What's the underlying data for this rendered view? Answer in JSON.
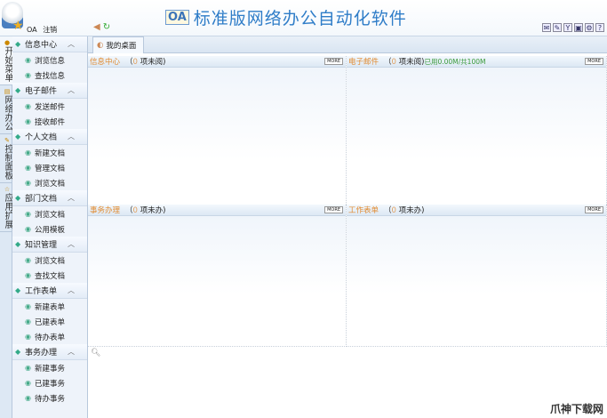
{
  "header": {
    "title": "标准版网络办公自动化软件",
    "logo": "OA",
    "user": "OA",
    "logout": "注销",
    "nav_icons": [
      "back-icon",
      "refresh-icon"
    ],
    "tool_icons": [
      "chat-icon",
      "edit-icon",
      "mail-icon",
      "image-icon",
      "settings-icon",
      "help-icon"
    ]
  },
  "vtabs": [
    {
      "label": "开始菜单",
      "icon": "bulb-icon"
    },
    {
      "label": "网络办公",
      "icon": "oa-icon"
    },
    {
      "label": "控制面板",
      "icon": "tools-icon"
    },
    {
      "label": "应用扩展",
      "icon": "star-icon"
    }
  ],
  "sidebar": {
    "groups": [
      {
        "label": "信息中心",
        "items": [
          "浏览信息",
          "查找信息"
        ]
      },
      {
        "label": "电子邮件",
        "items": [
          "发送邮件",
          "接收邮件"
        ]
      },
      {
        "label": "个人文档",
        "items": [
          "新建文档",
          "管理文档",
          "浏览文档"
        ]
      },
      {
        "label": "部门文档",
        "items": [
          "浏览文档",
          "公用模板"
        ]
      },
      {
        "label": "知识管理",
        "items": [
          "浏览文档",
          "查找文档"
        ]
      },
      {
        "label": "工作表单",
        "items": [
          "新建表单",
          "已建表单",
          "待办表单"
        ]
      },
      {
        "label": "事务办理",
        "items": [
          "新建事务",
          "已建事务",
          "待办事务"
        ]
      }
    ]
  },
  "tab": {
    "label": "我的桌面"
  },
  "panels": [
    {
      "title": "信息中心",
      "count": "0",
      "suffix": "项未阅)",
      "extra": "",
      "more": "MORE"
    },
    {
      "title": "电子邮件",
      "count": "0",
      "suffix": "项未阅)",
      "extra": "已用0.00M/共100M",
      "more": "MORE"
    },
    {
      "title": "事务办理",
      "count": "0",
      "suffix": "项未办)",
      "extra": "",
      "more": "MORE"
    },
    {
      "title": "工作表单",
      "count": "0",
      "suffix": "项未办)",
      "extra": "",
      "more": "MORE"
    }
  ],
  "open_paren": "（",
  "watermark": "爪神下载网"
}
